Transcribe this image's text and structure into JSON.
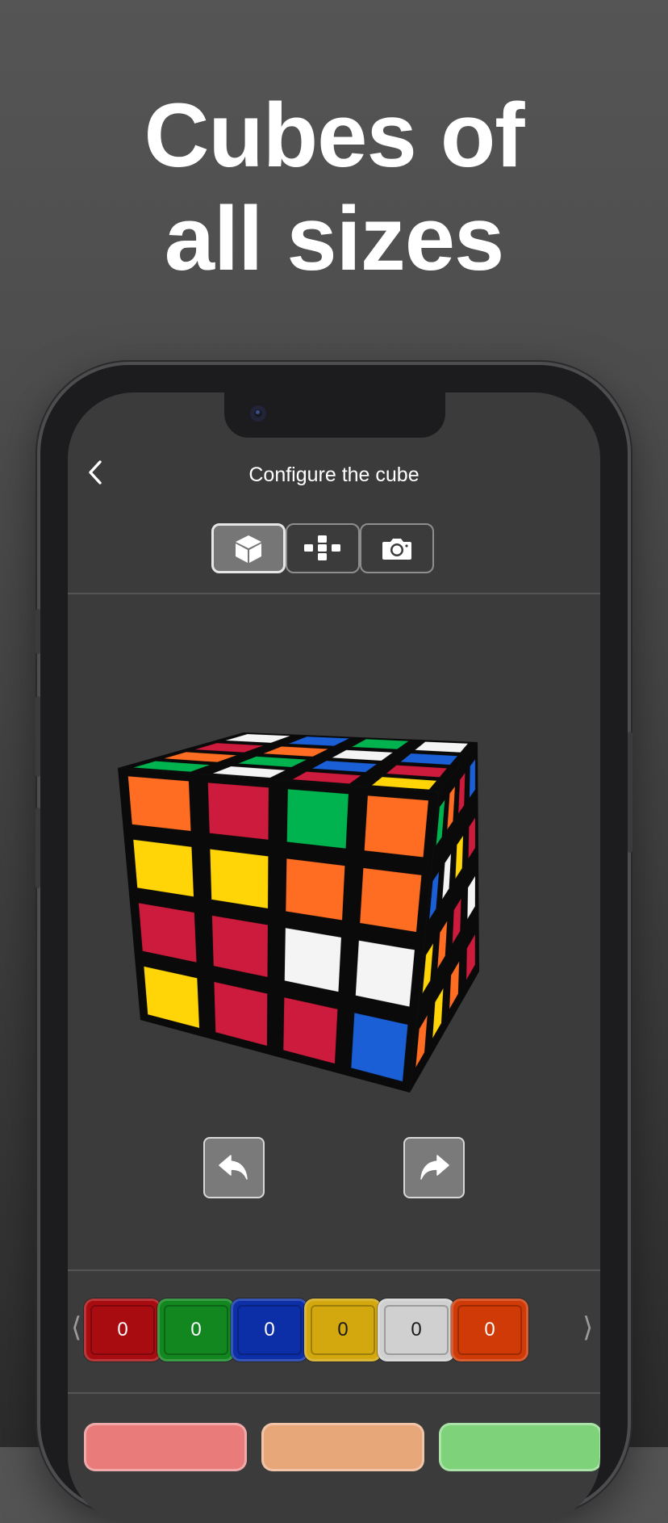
{
  "headline": {
    "line1": "Cubes of",
    "line2": "all sizes"
  },
  "nav": {
    "title": "Configure the cube",
    "back_icon": "chevron-left-icon"
  },
  "view_modes": [
    {
      "icon": "cube-3d-icon",
      "selected": true
    },
    {
      "icon": "cube-net-icon",
      "selected": false
    },
    {
      "icon": "camera-icon",
      "selected": false
    }
  ],
  "cube": {
    "size": 4,
    "front": [
      [
        "orange",
        "red",
        "green",
        "orange"
      ],
      [
        "yellow",
        "yellow",
        "orange",
        "orange"
      ],
      [
        "red",
        "red",
        "white",
        "white"
      ],
      [
        "yellow",
        "red",
        "red",
        "blue"
      ]
    ],
    "top": [
      [
        "white",
        "blue",
        "green",
        "white"
      ],
      [
        "red",
        "orange",
        "white",
        "blue"
      ],
      [
        "orange",
        "green",
        "blue",
        "red"
      ],
      [
        "green",
        "white",
        "red",
        "yellow"
      ]
    ],
    "right": [
      [
        "green",
        "orange",
        "red",
        "blue"
      ],
      [
        "blue",
        "white",
        "yellow",
        "red"
      ],
      [
        "yellow",
        "orange",
        "red",
        "white"
      ],
      [
        "orange",
        "yellow",
        "orange",
        "red"
      ]
    ]
  },
  "rotate": {
    "left_icon": "rotate-left-icon",
    "right_icon": "rotate-right-icon"
  },
  "color_counts": [
    {
      "name": "red",
      "value": "0",
      "color": "#a80b10"
    },
    {
      "name": "green",
      "value": "0",
      "color": "#12861f"
    },
    {
      "name": "blue",
      "value": "0",
      "color": "#0c2fa8"
    },
    {
      "name": "yellow",
      "value": "0",
      "color": "#d2a80e"
    },
    {
      "name": "white",
      "value": "0",
      "color": "#d0d0d0"
    },
    {
      "name": "orange",
      "value": "0",
      "color": "#cf3a06"
    }
  ],
  "colors_nav": {
    "prev": "⟨",
    "next": "⟩"
  },
  "bottom_buttons": [
    {
      "color": "#e97b7b"
    },
    {
      "color": "#e8a779"
    },
    {
      "color": "#7ed37a"
    }
  ],
  "palette": {
    "orange": "#ff6d22",
    "red": "#cc1b3c",
    "green": "#00b34f",
    "yellow": "#ffd507",
    "white": "#f4f4f4",
    "blue": "#1a5fd6"
  }
}
